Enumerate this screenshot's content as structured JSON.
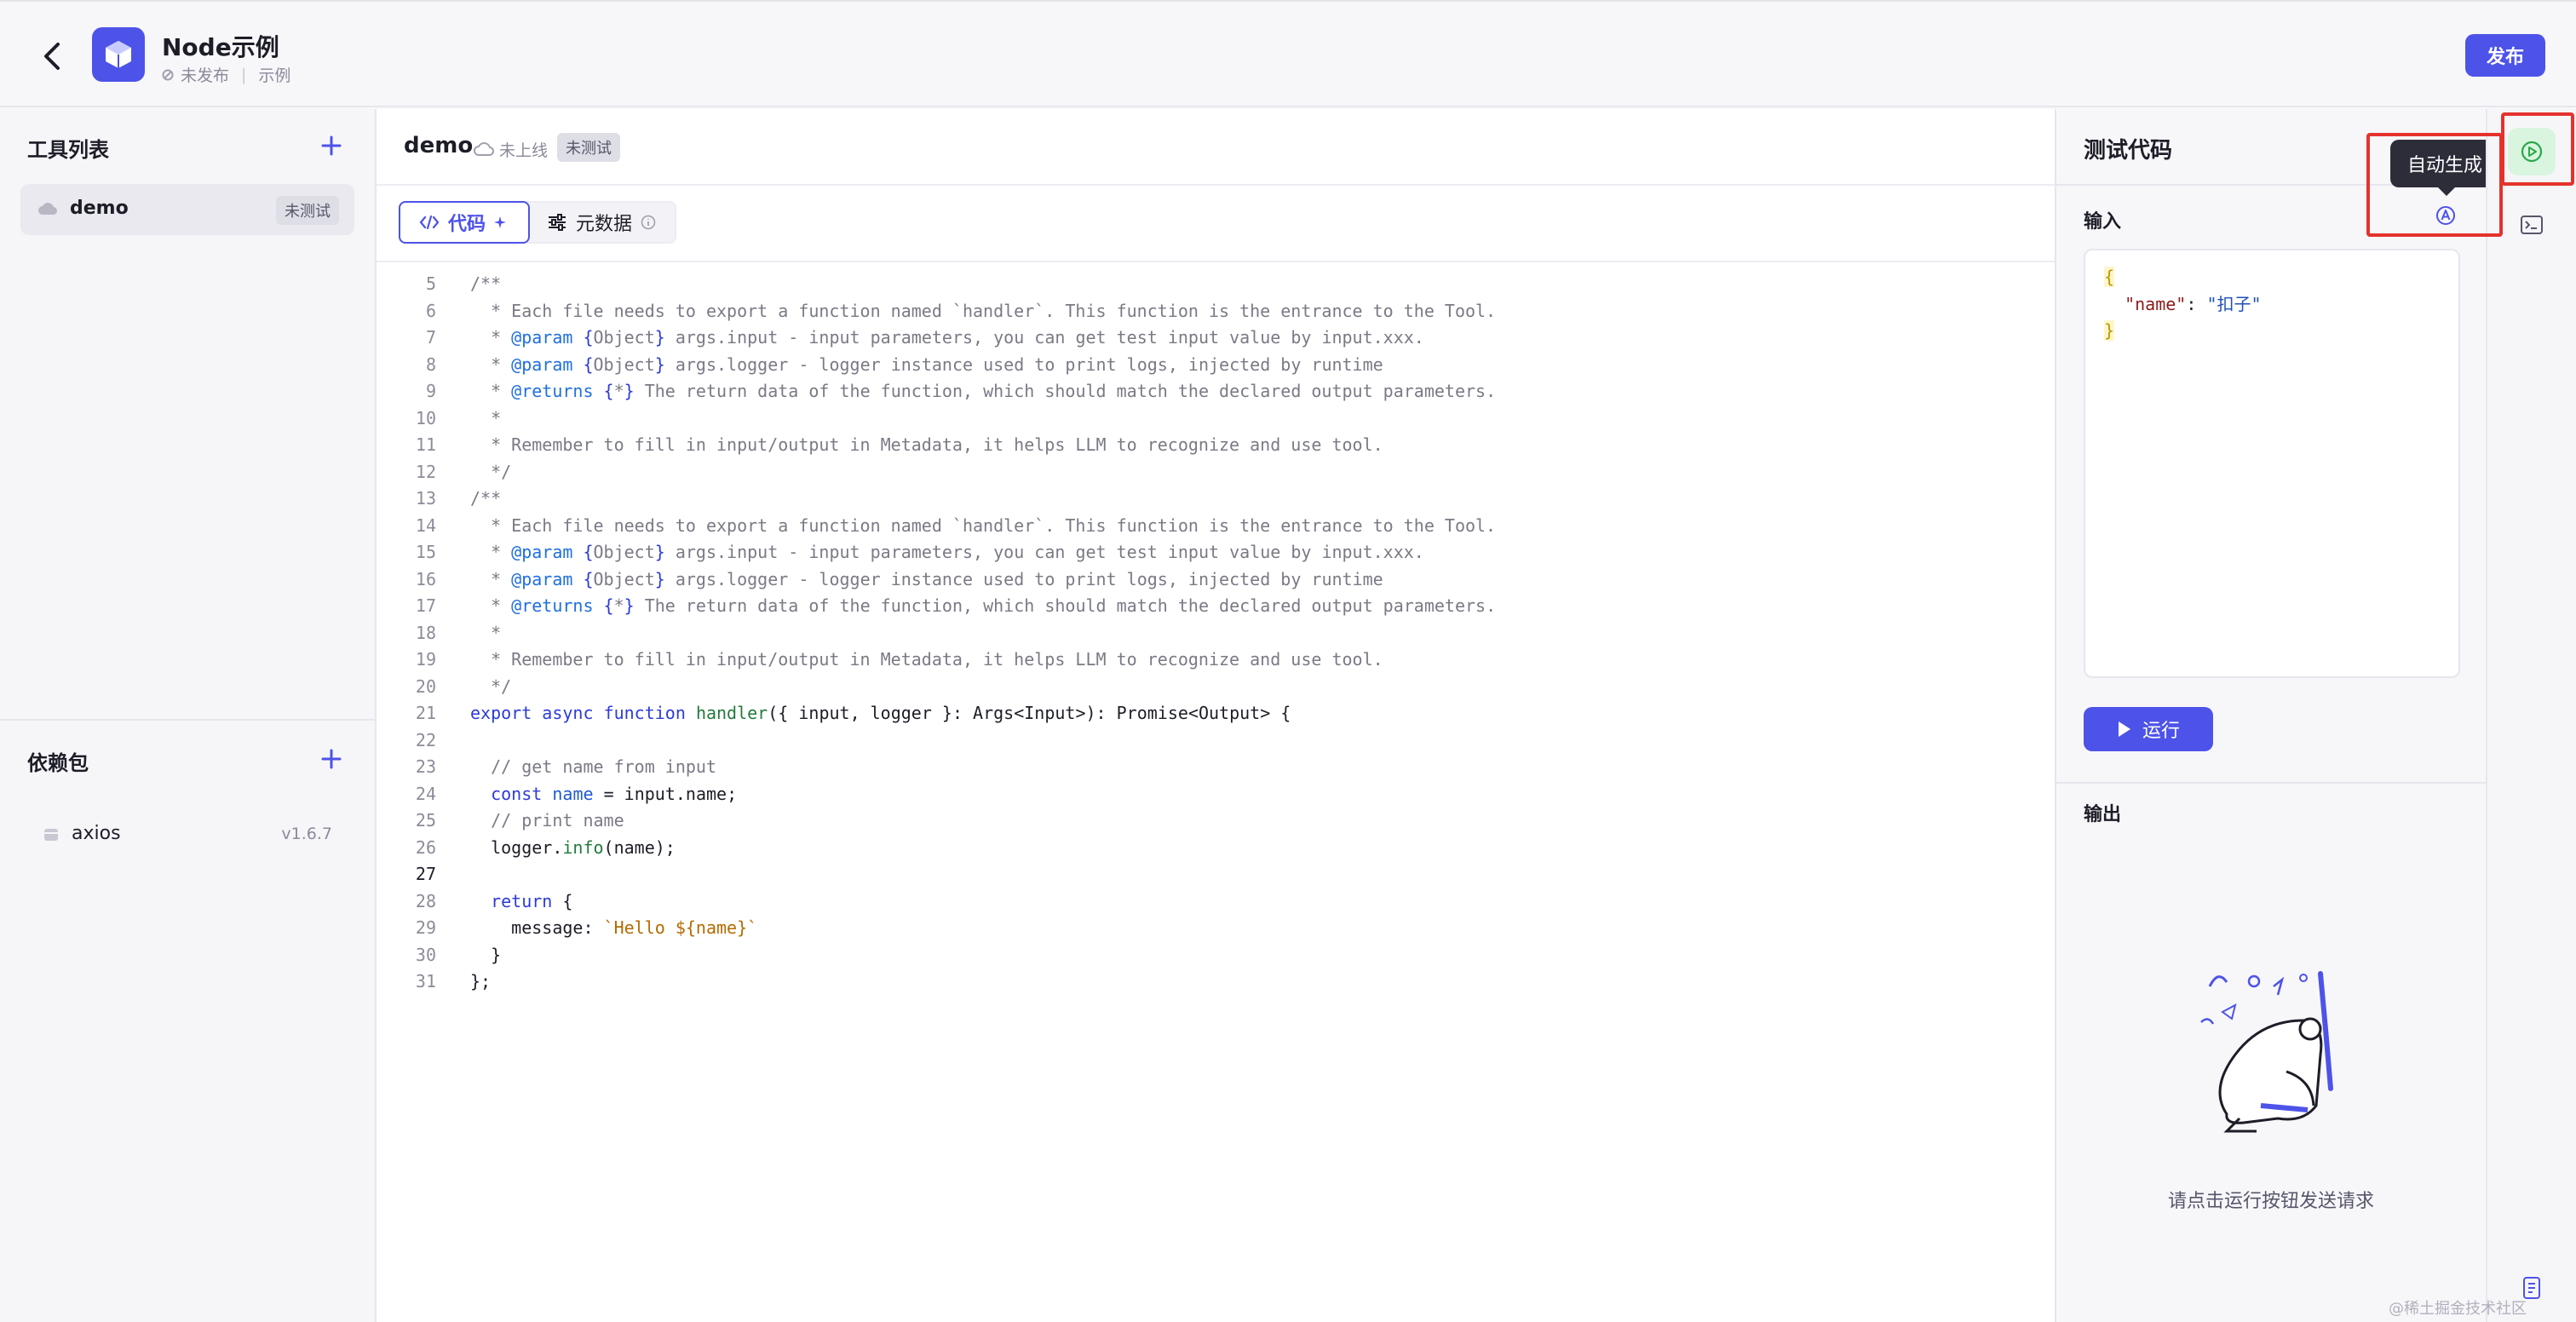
{
  "header": {
    "app_title": "Node示例",
    "status": "未发布",
    "category": "示例",
    "publish_label": "发布"
  },
  "sidebar": {
    "tools_title": "工具列表",
    "tools": [
      {
        "name": "demo",
        "badge": "未测试"
      }
    ],
    "deps_title": "依赖包",
    "deps": [
      {
        "name": "axios",
        "version": "v1.6.7"
      }
    ]
  },
  "editor": {
    "file_name": "demo",
    "online_status": "未上线",
    "test_badge": "未测试",
    "tabs": [
      {
        "label": "代码",
        "active": true
      },
      {
        "label": "元数据",
        "active": false
      }
    ],
    "current_line": 27,
    "code_lines": [
      {
        "n": 5,
        "t": "/**"
      },
      {
        "n": 6,
        "t": "  * Each file needs to export a function named `handler`. This function is the entrance to the Tool."
      },
      {
        "n": 7,
        "t": "  * @param {Object} args.input - input parameters, you can get test input value by input.xxx."
      },
      {
        "n": 8,
        "t": "  * @param {Object} args.logger - logger instance used to print logs, injected by runtime"
      },
      {
        "n": 9,
        "t": "  * @returns {*} The return data of the function, which should match the declared output parameters."
      },
      {
        "n": 10,
        "t": "  *"
      },
      {
        "n": 11,
        "t": "  * Remember to fill in input/output in Metadata, it helps LLM to recognize and use tool."
      },
      {
        "n": 12,
        "t": "  */"
      },
      {
        "n": 13,
        "t": "/**"
      },
      {
        "n": 14,
        "t": "  * Each file needs to export a function named `handler`. This function is the entrance to the Tool."
      },
      {
        "n": 15,
        "t": "  * @param {Object} args.input - input parameters, you can get test input value by input.xxx."
      },
      {
        "n": 16,
        "t": "  * @param {Object} args.logger - logger instance used to print logs, injected by runtime"
      },
      {
        "n": 17,
        "t": "  * @returns {*} The return data of the function, which should match the declared output parameters."
      },
      {
        "n": 18,
        "t": "  *"
      },
      {
        "n": 19,
        "t": "  * Remember to fill in input/output in Metadata, it helps LLM to recognize and use tool."
      },
      {
        "n": 20,
        "t": "  */"
      },
      {
        "n": 21,
        "t": "export async function handler({ input, logger }: Args<Input>): Promise<Output> {"
      },
      {
        "n": 22,
        "t": ""
      },
      {
        "n": 23,
        "t": "  // get name from input"
      },
      {
        "n": 24,
        "t": "  const name = input.name;"
      },
      {
        "n": 25,
        "t": "  // print name"
      },
      {
        "n": 26,
        "t": "  logger.info(name);"
      },
      {
        "n": 27,
        "t": ""
      },
      {
        "n": 28,
        "t": "  return {"
      },
      {
        "n": 29,
        "t": "    message: `Hello ${name}`"
      },
      {
        "n": 30,
        "t": "  }"
      },
      {
        "n": 31,
        "t": "};"
      }
    ]
  },
  "test_panel": {
    "title": "测试代码",
    "input_label": "输入",
    "autogen_tooltip": "自动生成",
    "input_json": [
      "{",
      "  \"name\": \"扣子\"",
      "}"
    ],
    "run_label": "运行",
    "output_label": "输出",
    "empty_hint": "请点击运行按钮发送请求"
  },
  "watermark": "@稀土掘金技术社区",
  "colors": {
    "accent": "#4d53e8",
    "highlight": "#e5322d",
    "run_icon_bg": "#d9f5e0"
  },
  "icons": {
    "back": "chevron-left-icon",
    "logo": "cube-icon",
    "cloud": "cloud-icon",
    "add": "plus-icon",
    "package": "package-icon",
    "code_tab": "code-icon",
    "metadata_tab": "sliders-icon",
    "info": "info-icon",
    "autogen": "auto-generate-icon",
    "run": "play-icon",
    "console": "terminal-icon",
    "doc": "document-icon"
  }
}
